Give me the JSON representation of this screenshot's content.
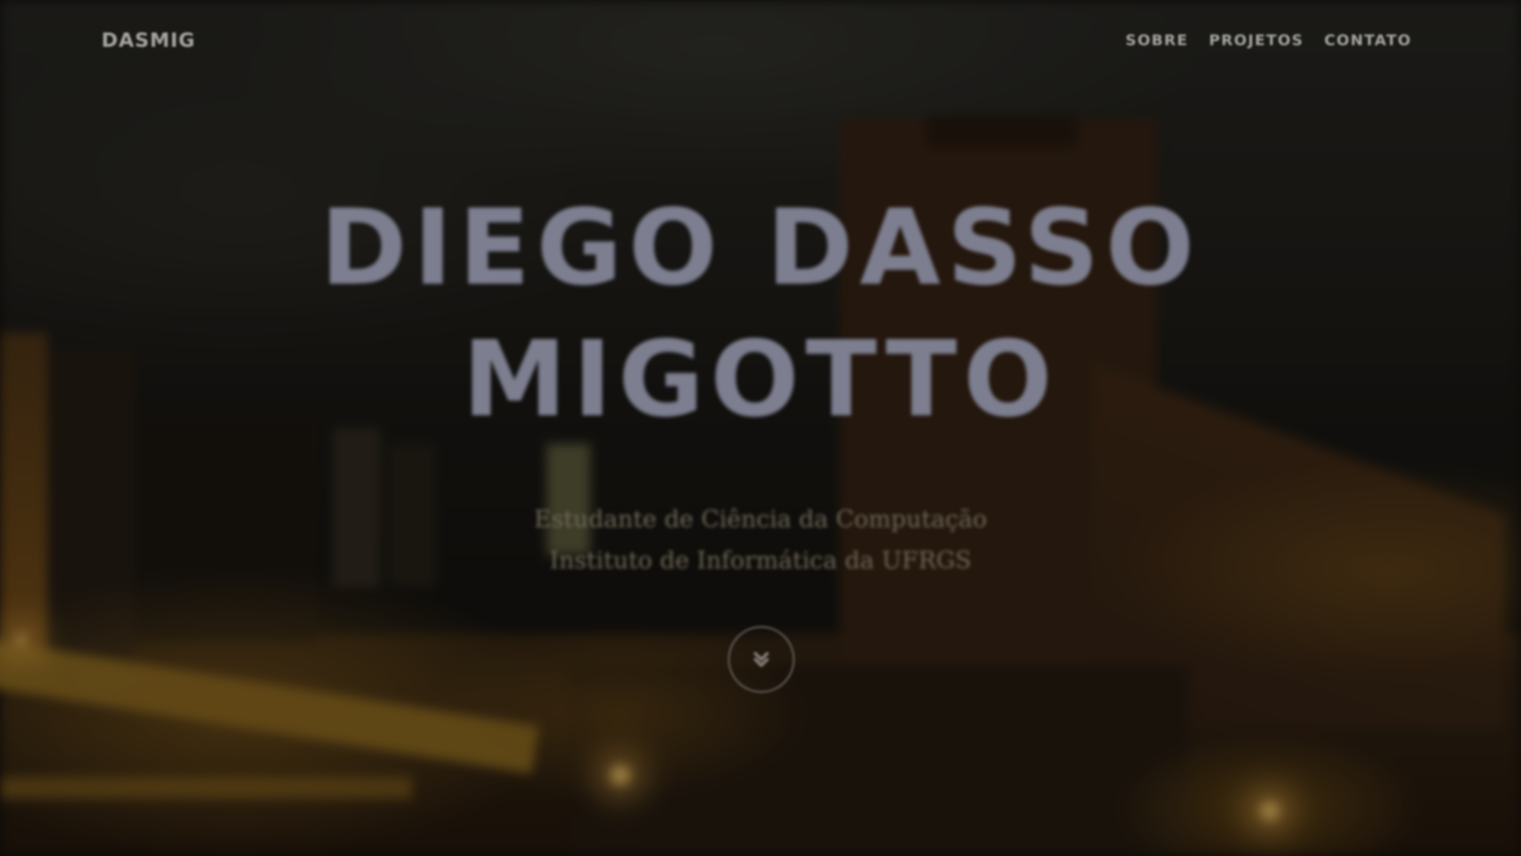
{
  "nav": {
    "brand": "DASMIG",
    "links": [
      "SOBRE",
      "PROJETOS",
      "CONTATO"
    ]
  },
  "hero": {
    "title_line1": "DIEGO DASSO",
    "title_line2": "MIGOTTO",
    "subtitle_line1": "Estudante de Ciência da Computação",
    "subtitle_line2": "Instituto de Informática da UFRGS",
    "scroll_icon": "chevron-double-down-icon"
  },
  "colors": {
    "title": "#7d7f90",
    "nav_text": "#a7a5a0",
    "overlay": "#000000"
  }
}
